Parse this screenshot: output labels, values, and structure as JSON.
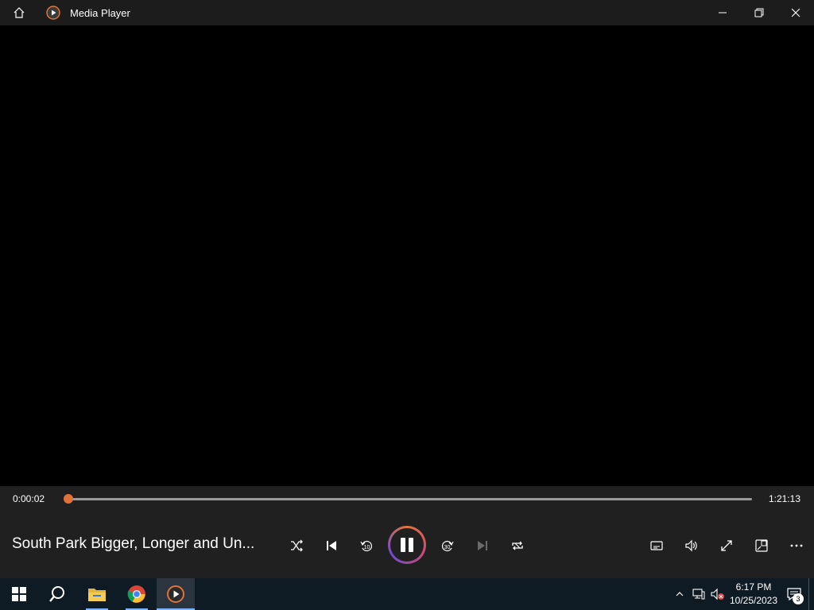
{
  "app": {
    "title": "Media Player"
  },
  "player": {
    "current_time": "0:00:02",
    "total_time": "1:21:13",
    "progress": 0.0004,
    "media_title": "South Park Bigger, Longer and Un...",
    "accent": "#e0733a"
  },
  "controls": [
    "shuffle-icon",
    "previous-icon",
    "rewind-10-icon",
    "play-pause-icon",
    "forward-30-icon",
    "next-icon",
    "repeat-icon",
    "captions-icon",
    "volume-icon",
    "fullscreen-icon",
    "mini-player-icon",
    "more-icon"
  ],
  "rewind_label": "10",
  "forward_label": "30",
  "taskbar": {
    "clock_time": "6:17 PM",
    "clock_date": "10/25/2023",
    "notification_count": "3"
  }
}
